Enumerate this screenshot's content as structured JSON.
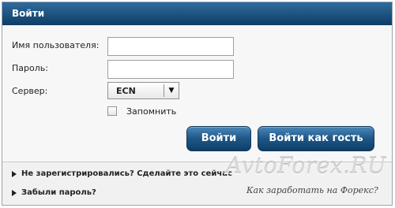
{
  "dialog": {
    "title": "Войти",
    "username_label": "Имя пользователя:",
    "username_value": "",
    "password_label": "Пароль:",
    "password_value": "",
    "server_label": "Сервер:",
    "server_selected": "ECN",
    "remember_label": "Запомнить",
    "remember_checked": false,
    "login_button": "Войти",
    "guest_button": "Войти как гость"
  },
  "footer": {
    "register_link": "Не зарегистрировались? Сделайте это сейчас",
    "forgot_link": "Забыли пароль?"
  },
  "watermark": {
    "site": "AvtoForex.RU",
    "tagline": "Как заработать на Форекс?"
  },
  "icons": {
    "dropdown": "chevron-down-icon",
    "bullet": "triangle-right-icon"
  },
  "colors": {
    "title_bar": "#1b4f7e",
    "button": "#1d5788"
  }
}
